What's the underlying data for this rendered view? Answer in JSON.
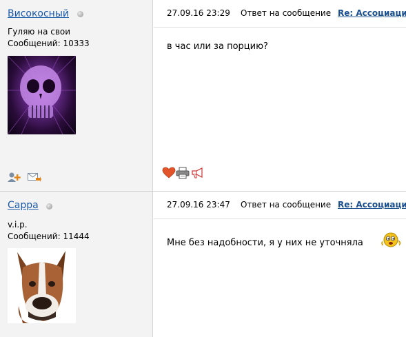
{
  "posts": [
    {
      "author": {
        "name": "Високосный",
        "rank": "Гуляю на свои",
        "messages_label": "Сообщений:",
        "messages_count": "10333",
        "status": "offline"
      },
      "date": "27.09.16 23:29",
      "reply_prefix": "Ответ на сообщение",
      "reply_link": "Re: Ассоциации",
      "body": "в час или за порцию?",
      "user_action_icons": [
        "add-friend-icon",
        "send-message-icon"
      ],
      "post_action_icons": [
        "like-heart-icon",
        "print-icon",
        "report-megaphone-icon"
      ]
    },
    {
      "author": {
        "name": "Cappa",
        "rank": "v.i.p.",
        "messages_label": "Сообщений:",
        "messages_count": "11444",
        "status": "offline"
      },
      "date": "27.09.16 23:47",
      "reply_prefix": "Ответ на сообщение",
      "reply_link": "Re: Ассоциации",
      "body": "Мне без надобности, я у них не уточняла",
      "body_icon": "smiley-icon"
    }
  ],
  "colors": {
    "author_link": "#1a58a8",
    "reply_link": "#1a4f8f",
    "sidebar_bg": "#f3f3f3"
  }
}
